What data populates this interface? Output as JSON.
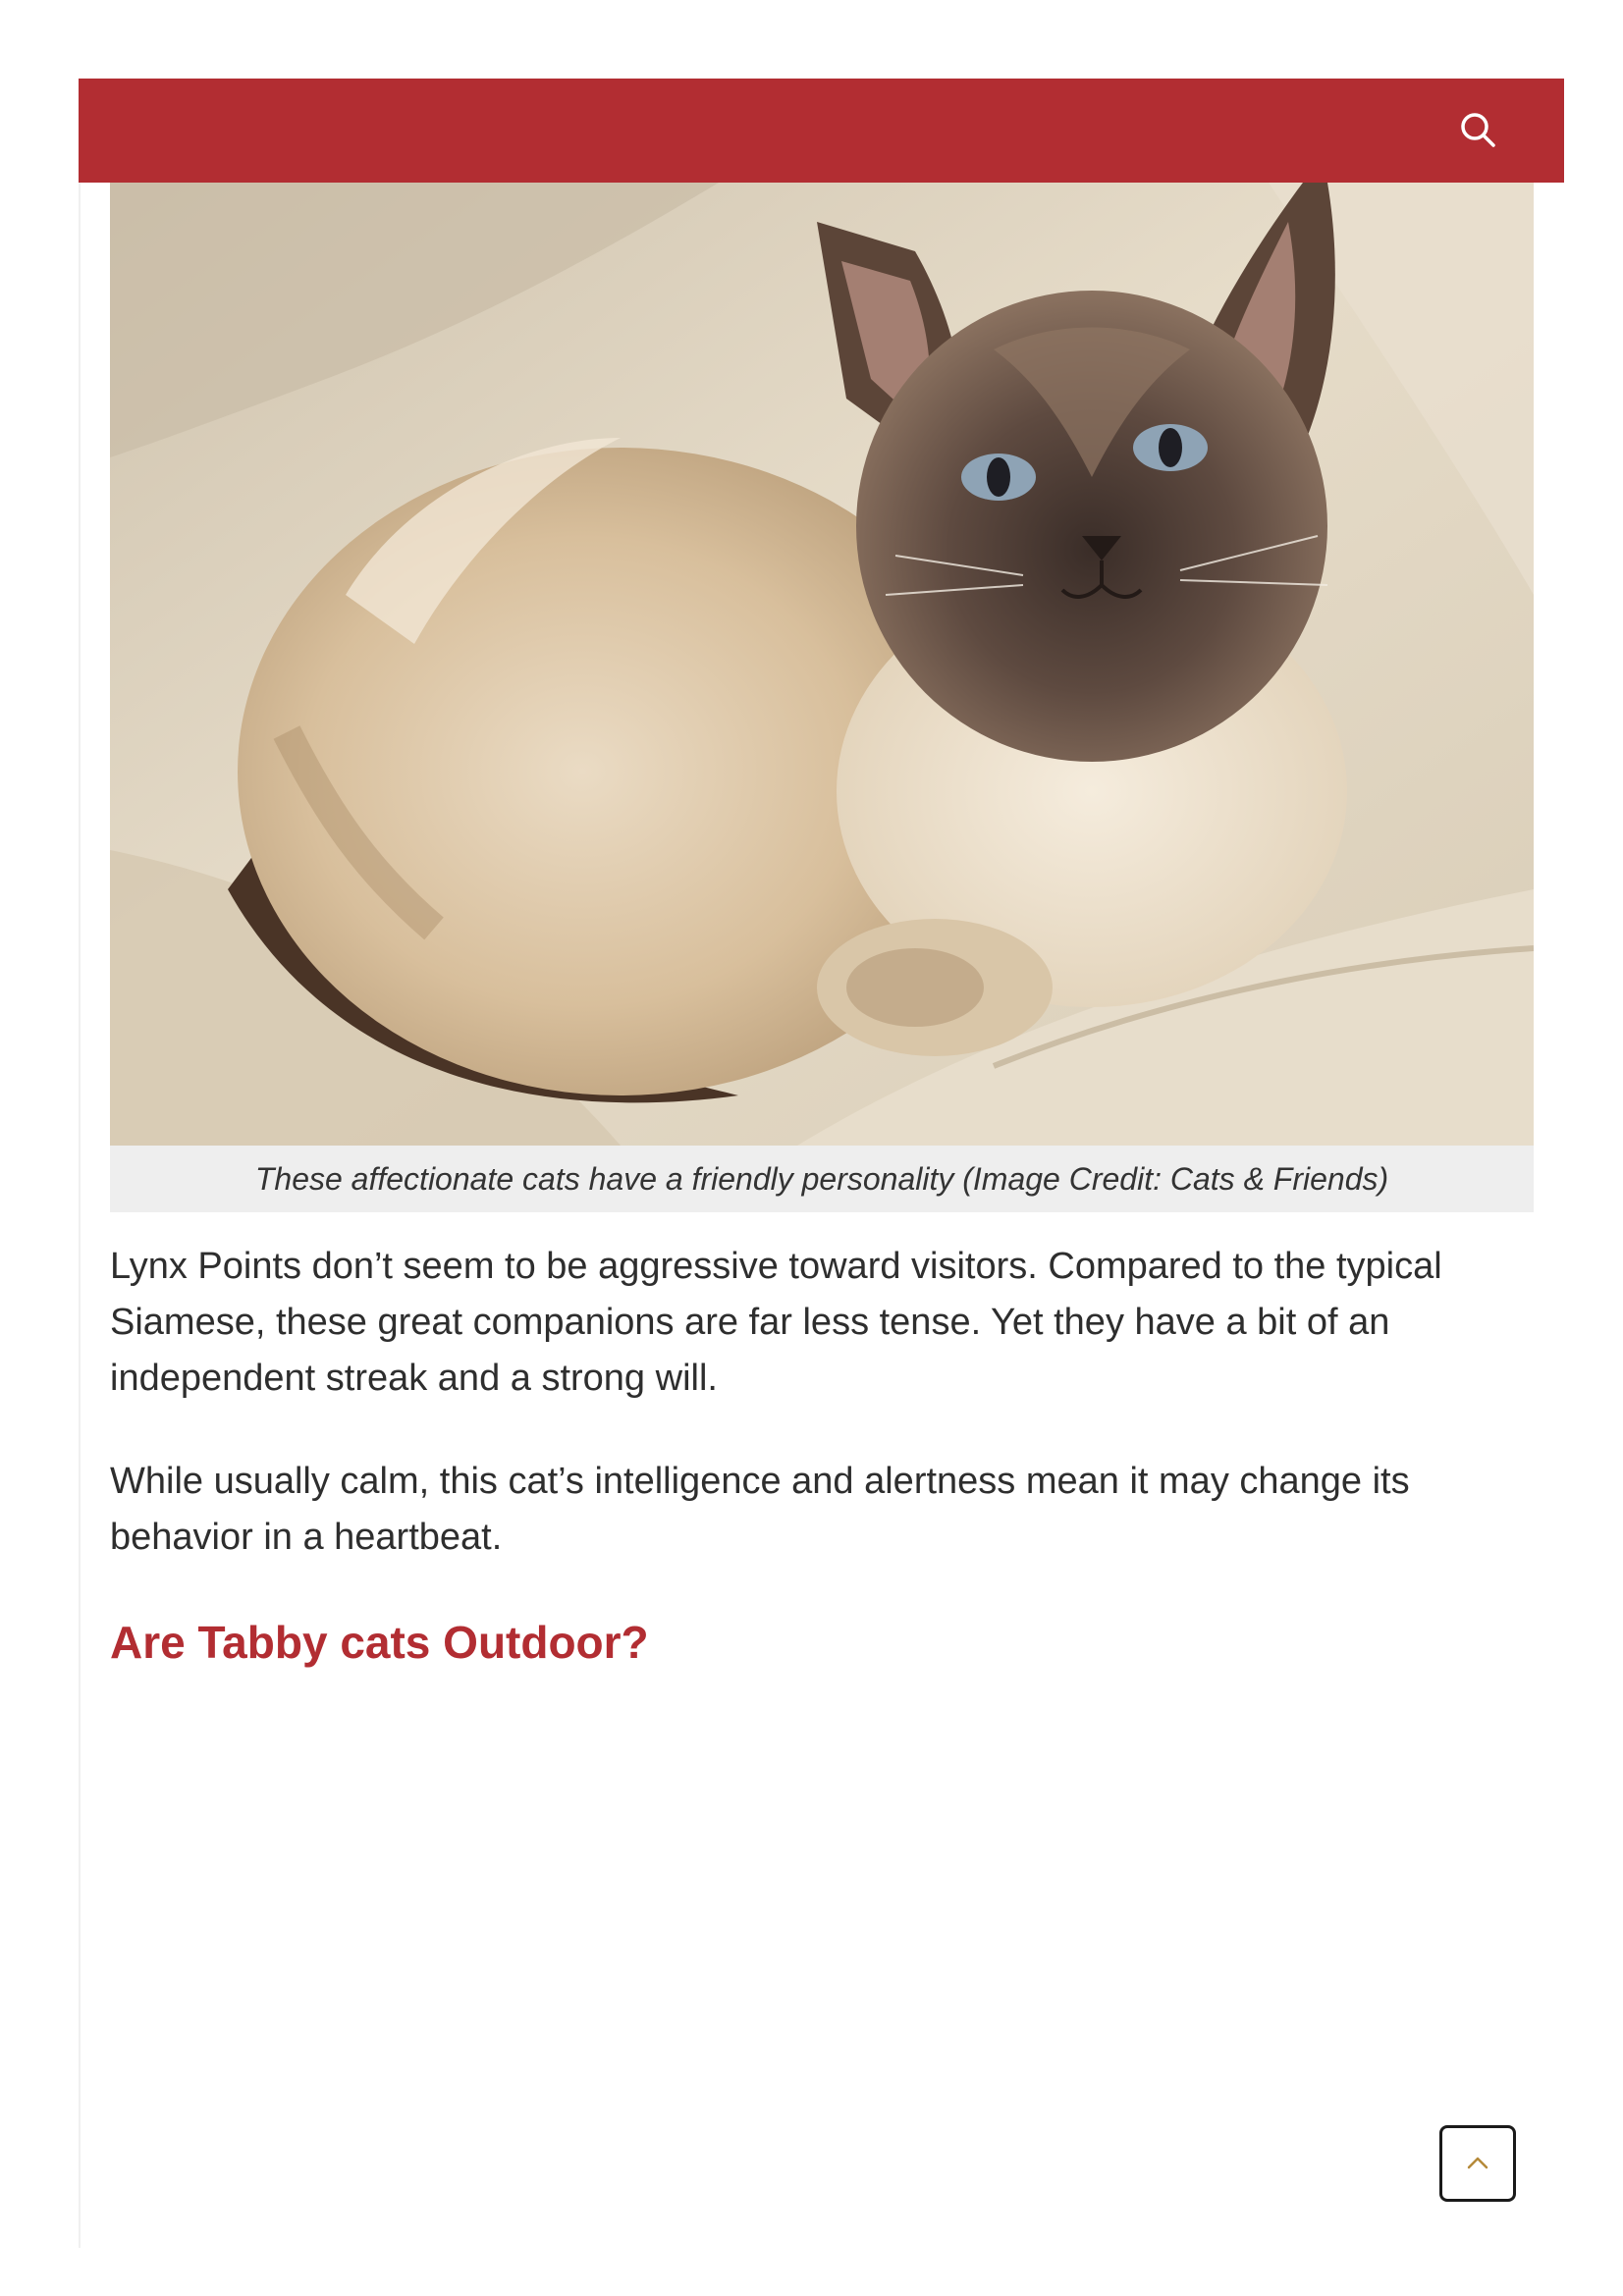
{
  "header": {
    "bg_color": "#b22d32",
    "search_icon": "search-icon"
  },
  "figure": {
    "image_alt": "Lynx point Siamese cat lying on a cream fleece bed",
    "caption": "These affectionate cats have a friendly personality (Image Credit: Cats & Friends)"
  },
  "article": {
    "paragraphs": [
      "Lynx Points don’t seem to be aggressive toward visitors. Compared to the typical Siamese, these great companions are far less tense. Yet they have a bit of an independent streak and a strong will.",
      "While usually calm, this cat’s intelligence and alertness mean it may change its behavior in a heartbeat."
    ],
    "heading": "Are Tabby cats Outdoor?",
    "heading_color": "#b22d32"
  },
  "scroll_top": {
    "icon": "chevron-up-icon"
  }
}
